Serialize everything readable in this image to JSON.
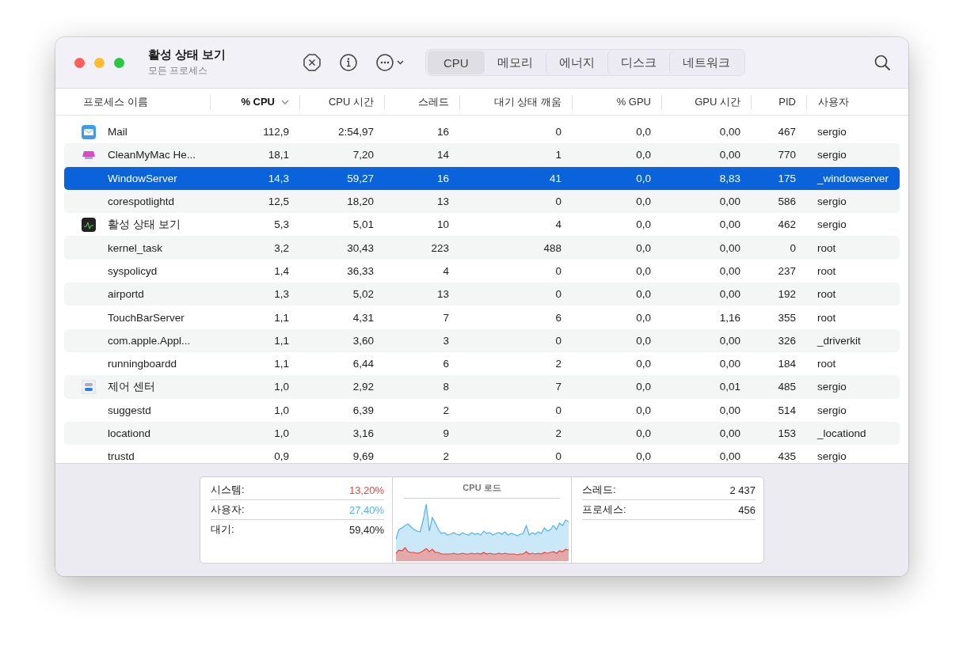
{
  "window": {
    "title": "활성 상태 보기",
    "subtitle": "모든 프로세스"
  },
  "tabs": [
    {
      "label": "CPU",
      "selected": true
    },
    {
      "label": "메모리",
      "selected": false
    },
    {
      "label": "에너지",
      "selected": false
    },
    {
      "label": "디스크",
      "selected": false
    },
    {
      "label": "네트워크",
      "selected": false
    }
  ],
  "table": {
    "columns": [
      {
        "label": "프로세스 이름",
        "sorted": false
      },
      {
        "label": "% CPU",
        "sorted": true
      },
      {
        "label": "CPU 시간",
        "sorted": false
      },
      {
        "label": "스레드",
        "sorted": false
      },
      {
        "label": "대기 상태 깨움",
        "sorted": false
      },
      {
        "label": "% GPU",
        "sorted": false
      },
      {
        "label": "GPU 시간",
        "sorted": false
      },
      {
        "label": "PID",
        "sorted": false
      },
      {
        "label": "사용자",
        "sorted": false
      }
    ],
    "rows": [
      {
        "kind": "mail",
        "cells": [
          "Mail",
          "112,9",
          "2:54,97",
          "16",
          "0",
          "0,0",
          "0,00",
          "467",
          "sergio"
        ],
        "selected": false
      },
      {
        "kind": "cleaner",
        "cells": [
          "CleanMyMac He...",
          "18,1",
          "7,20",
          "14",
          "1",
          "0,0",
          "0,00",
          "770",
          "sergio"
        ],
        "selected": false
      },
      {
        "cells": [
          "WindowServer",
          "14,3",
          "59,27",
          "16",
          "41",
          "0,0",
          "8,83",
          "175",
          "_windowserver"
        ],
        "selected": true
      },
      {
        "cells": [
          "corespotlightd",
          "12,5",
          "18,20",
          "13",
          "0",
          "0,0",
          "0,00",
          "586",
          "sergio"
        ],
        "selected": false
      },
      {
        "kind": "activity",
        "cells": [
          "활성 상태 보기",
          "5,3",
          "5,01",
          "10",
          "4",
          "0,0",
          "0,00",
          "462",
          "sergio"
        ],
        "selected": false
      },
      {
        "cells": [
          "kernel_task",
          "3,2",
          "30,43",
          "223",
          "488",
          "0,0",
          "0,00",
          "0",
          "root"
        ],
        "selected": false
      },
      {
        "cells": [
          "syspolicyd",
          "1,4",
          "36,33",
          "4",
          "0",
          "0,0",
          "0,00",
          "237",
          "root"
        ],
        "selected": false
      },
      {
        "cells": [
          "airportd",
          "1,3",
          "5,02",
          "13",
          "0",
          "0,0",
          "0,00",
          "192",
          "root"
        ],
        "selected": false
      },
      {
        "cells": [
          "TouchBarServer",
          "1,1",
          "4,31",
          "7",
          "6",
          "0,0",
          "1,16",
          "355",
          "root"
        ],
        "selected": false
      },
      {
        "cells": [
          "com.apple.Appl...",
          "1,1",
          "3,60",
          "3",
          "0",
          "0,0",
          "0,00",
          "326",
          "_driverkit"
        ],
        "selected": false
      },
      {
        "cells": [
          "runningboardd",
          "1,1",
          "6,44",
          "6",
          "2",
          "0,0",
          "0,00",
          "184",
          "root"
        ],
        "selected": false
      },
      {
        "kind": "control",
        "cells": [
          "제어 센터",
          "1,0",
          "2,92",
          "8",
          "7",
          "0,0",
          "0,01",
          "485",
          "sergio"
        ],
        "selected": false
      },
      {
        "cells": [
          "suggestd",
          "1,0",
          "6,39",
          "2",
          "0",
          "0,0",
          "0,00",
          "514",
          "sergio"
        ],
        "selected": false
      },
      {
        "cells": [
          "locationd",
          "1,0",
          "3,16",
          "9",
          "2",
          "0,0",
          "0,00",
          "153",
          "_locationd"
        ],
        "selected": false
      },
      {
        "cells": [
          "trustd",
          "0,9",
          "9,69",
          "2",
          "0",
          "0,0",
          "0,00",
          "435",
          "sergio"
        ],
        "selected": false
      }
    ]
  },
  "summary": {
    "load": [
      {
        "label": "시스템:",
        "value": "13,20%",
        "color": "#f0413a"
      },
      {
        "label": "사용자:",
        "value": "27,40%",
        "color": "#4db3f0"
      },
      {
        "label": "대기:",
        "value": "59,40%",
        "color": "#1d1d1f"
      }
    ],
    "chart": {
      "title": "CPU 로드"
    },
    "counts": [
      {
        "label": "스레드:",
        "value": "2 437"
      },
      {
        "label": "프로세스:",
        "value": "456"
      }
    ]
  }
}
